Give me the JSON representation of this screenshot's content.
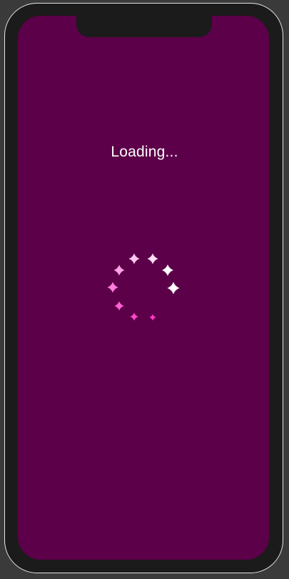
{
  "loading": {
    "text": "Loading..."
  },
  "spinner": {
    "icon": "sparkle-icon",
    "count": 9,
    "colors": [
      "#ffffff",
      "#ffffff",
      "#ffdcf7",
      "#ffc6f0",
      "#ff9fe6",
      "#ff7cdc",
      "#ff60d4",
      "#ff48cc",
      "#ff38c6"
    ]
  },
  "colors": {
    "screen_background": "#5c0049",
    "device_frame": "#1b1b1b",
    "page_background": "#3a3a3a"
  }
}
